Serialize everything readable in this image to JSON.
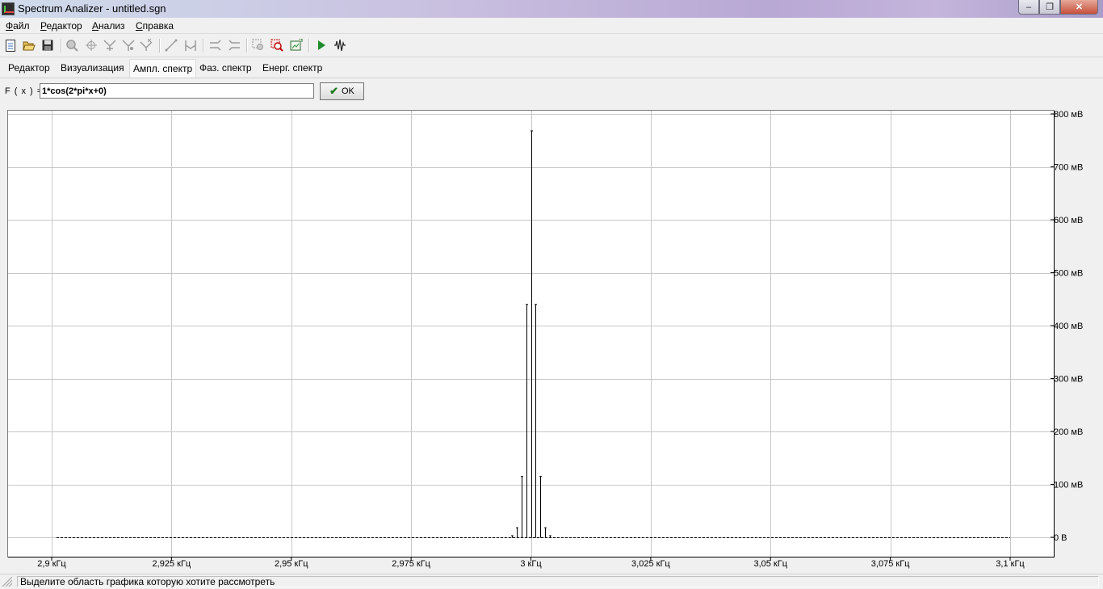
{
  "window": {
    "title": "Spectrum Analizer - untitled.sgn",
    "minimize": "‒",
    "maximize": "❐",
    "close": "✕"
  },
  "menu": [
    {
      "label_u": "Ф",
      "label_rest": "айл"
    },
    {
      "label_u": "Р",
      "label_rest": "едактор"
    },
    {
      "label_u": "А",
      "label_rest": "нализ"
    },
    {
      "label_u": "С",
      "label_rest": "правка"
    }
  ],
  "toolbar": {
    "icons": [
      "new-file-icon",
      "open-folder-icon",
      "save-icon",
      "zoom-icon",
      "crosshair-icon",
      "filter-icon",
      "filter-alt-icon",
      "filter-x-icon",
      "line-icon",
      "bracket-icon",
      "shift-left-icon",
      "shift-right-icon",
      "zoom-area-icon",
      "zoom-reset-icon",
      "export-image-icon",
      "play-icon",
      "waveform-icon"
    ]
  },
  "tabs": [
    {
      "label": "Редактор"
    },
    {
      "label": "Визуализация"
    },
    {
      "label": "Ампл. спектр",
      "active": true
    },
    {
      "label": "Фаз. спектр"
    },
    {
      "label": "Енерг. спектр"
    }
  ],
  "formula": {
    "label": "F ( x ) =",
    "value": "1*cos(2*pi*x+0)",
    "ok_label": "OK"
  },
  "chart_data": {
    "type": "bar",
    "xlabel": "",
    "ylabel": "",
    "x_unit": "кГц",
    "xlim": [
      2.8965,
      3.1035
    ],
    "ylim": [
      -0.038,
      0.8
    ],
    "x_ticks": [
      {
        "value": 2.9,
        "label": "2,9 кГц"
      },
      {
        "value": 2.925,
        "label": "2,925 кГц"
      },
      {
        "value": 2.95,
        "label": "2,95 кГц"
      },
      {
        "value": 2.975,
        "label": "2,975 кГц"
      },
      {
        "value": 3.0,
        "label": "3 кГц"
      },
      {
        "value": 3.025,
        "label": "3,025 кГц"
      },
      {
        "value": 3.05,
        "label": "3,05 кГц"
      },
      {
        "value": 3.075,
        "label": "3,075 кГц"
      },
      {
        "value": 3.1,
        "label": "3,1 кГц"
      }
    ],
    "y_ticks": [
      {
        "value": 0.0,
        "label": "0 В"
      },
      {
        "value": 0.1,
        "label": "100 мВ"
      },
      {
        "value": 0.2,
        "label": "200 мВ"
      },
      {
        "value": 0.3,
        "label": "300 мВ"
      },
      {
        "value": 0.4,
        "label": "400 мВ"
      },
      {
        "value": 0.5,
        "label": "500 мВ"
      },
      {
        "value": 0.6,
        "label": "600 мВ"
      },
      {
        "value": 0.7,
        "label": "700 мВ"
      },
      {
        "value": 0.8,
        "label": "800 мВ"
      }
    ],
    "grid": true,
    "baseline_range": [
      2.901,
      3.1
    ],
    "spectral_lines": [
      {
        "x": 2.996,
        "y": 0.003
      },
      {
        "x": 2.997,
        "y": 0.018
      },
      {
        "x": 2.998,
        "y": 0.115
      },
      {
        "x": 2.999,
        "y": 0.44
      },
      {
        "x": 3.0,
        "y": 0.768
      },
      {
        "x": 3.001,
        "y": 0.44
      },
      {
        "x": 3.002,
        "y": 0.115
      },
      {
        "x": 3.003,
        "y": 0.018
      },
      {
        "x": 3.004,
        "y": 0.003
      }
    ]
  },
  "status": {
    "text": "Выделите область графика которую хотите рассмотреть"
  }
}
